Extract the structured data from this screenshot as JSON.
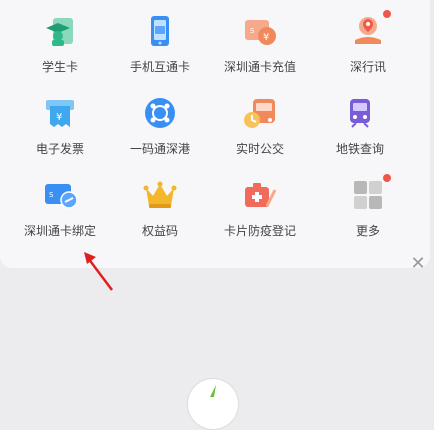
{
  "services": [
    {
      "label": "学生卡",
      "icon": "student-card-icon"
    },
    {
      "label": "手机互通卡",
      "icon": "phone-transit-card-icon"
    },
    {
      "label": "深圳通卡充值",
      "icon": "card-recharge-icon"
    },
    {
      "label": "深行讯",
      "icon": "shenxingxun-icon",
      "badge": true
    },
    {
      "label": "电子发票",
      "icon": "e-invoice-icon"
    },
    {
      "label": "一码通深港",
      "icon": "qr-sz-hk-icon"
    },
    {
      "label": "实时公交",
      "icon": "realtime-bus-icon"
    },
    {
      "label": "地铁查询",
      "icon": "metro-query-icon"
    },
    {
      "label": "深圳通卡绑定",
      "icon": "card-bind-icon"
    },
    {
      "label": "权益码",
      "icon": "crown-icon"
    },
    {
      "label": "卡片防疫登记",
      "icon": "epidemic-register-icon"
    },
    {
      "label": "更多",
      "icon": "more-grid-icon",
      "badge": true
    }
  ],
  "colors": {
    "badge": "#f0564a",
    "green": "#2fb98a",
    "blue": "#3a8ff5",
    "orange": "#f08a5d",
    "purple": "#7a5cd6",
    "gold": "#f3b62d",
    "gray": "#b8b8b8"
  },
  "close_glyph": "✕"
}
